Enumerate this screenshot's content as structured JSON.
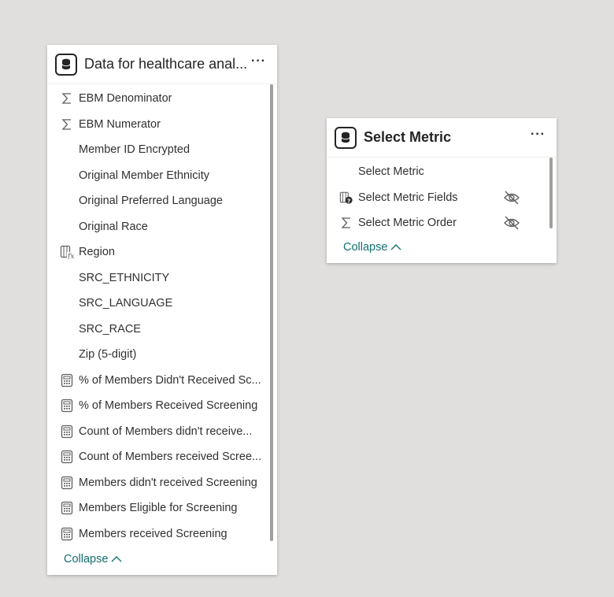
{
  "left_card": {
    "title": "Data for healthcare anal...",
    "more_label": "···",
    "collapse_label": "Collapse",
    "fields": [
      {
        "label": "EBM Denominator",
        "icon": "sigma-icon"
      },
      {
        "label": "EBM Numerator",
        "icon": "sigma-icon"
      },
      {
        "label": "Member ID Encrypted",
        "icon": ""
      },
      {
        "label": "Original Member Ethnicity",
        "icon": ""
      },
      {
        "label": "Original Preferred Language",
        "icon": ""
      },
      {
        "label": "Original Race",
        "icon": ""
      },
      {
        "label": "Region",
        "icon": "calculated-column-icon"
      },
      {
        "label": "SRC_ETHNICITY",
        "icon": ""
      },
      {
        "label": "SRC_LANGUAGE",
        "icon": ""
      },
      {
        "label": "SRC_RACE",
        "icon": ""
      },
      {
        "label": "Zip (5-digit)",
        "icon": ""
      },
      {
        "label": "% of Members Didn't Received Sc...",
        "icon": "calculator-icon"
      },
      {
        "label": "% of Members Received Screening",
        "icon": "calculator-icon"
      },
      {
        "label": "Count of Members didn't receive...",
        "icon": "calculator-icon"
      },
      {
        "label": "Count of Members received Scree...",
        "icon": "calculator-icon"
      },
      {
        "label": "Members didn't received Screening",
        "icon": "calculator-icon"
      },
      {
        "label": "Members Eligible for Screening",
        "icon": "calculator-icon"
      },
      {
        "label": "Members received Screening",
        "icon": "calculator-icon"
      }
    ]
  },
  "right_card": {
    "title": "Select Metric",
    "more_label": "···",
    "collapse_label": "Collapse",
    "fields": [
      {
        "label": "Select Metric",
        "icon": "",
        "hidden": false
      },
      {
        "label": "Select Metric Fields",
        "icon": "field-parameter-icon",
        "hidden": true
      },
      {
        "label": "Select Metric Order",
        "icon": "sigma-icon",
        "hidden": true
      }
    ]
  },
  "colors": {
    "canvas": "#e1dfdd",
    "card": "#ffffff",
    "text": "#323130",
    "link": "#12706e",
    "icon": "#605e5c"
  }
}
